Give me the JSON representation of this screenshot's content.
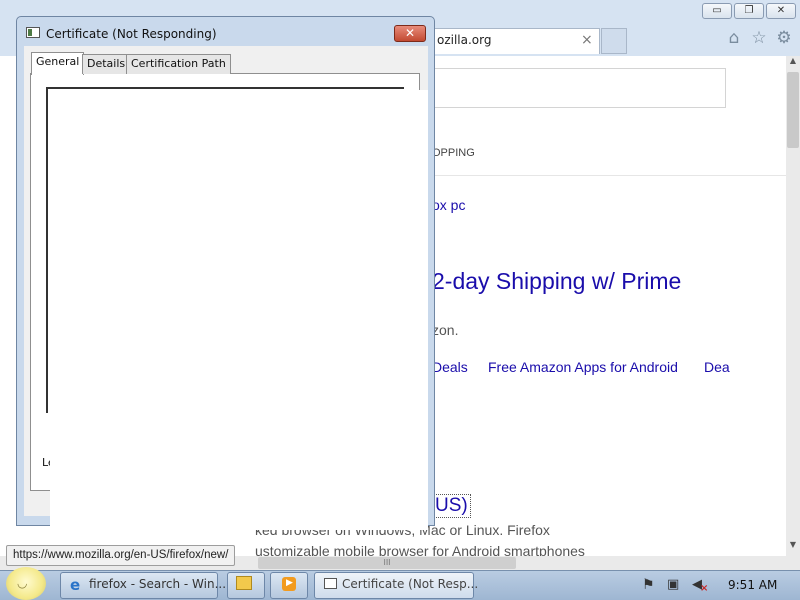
{
  "browser": {
    "tab": {
      "label": "ozilla.org",
      "close": "×"
    },
    "window_buttons": {
      "minimize": "▭",
      "maximize": "❐",
      "close": "✕"
    },
    "toolbar_icons": [
      "home-icon",
      "star-icon",
      "gear-icon"
    ]
  },
  "page": {
    "search_query": "",
    "nav_item": "OPPING",
    "related_search": "ox pc",
    "ad": {
      "title": "2-day Shipping w/ Prime",
      "description": "zon.",
      "sitelinks": [
        "Deals",
        "Free Amazon Apps for Android",
        "Dea"
      ]
    },
    "result": {
      "title": "US)",
      "desc_line_1": "ked browser on Windows, Mac or Linux. Firefox",
      "desc_line_2": "ustomizable mobile browser for Android smartphones"
    },
    "status_url": "https://www.mozilla.org/en-US/firefox/new/",
    "scroll_glyphs": {
      "up": "▲",
      "down": "▼",
      "grip": "III"
    }
  },
  "dialog": {
    "title": "Certificate (Not Responding)",
    "close": "✕",
    "tabs": [
      "General",
      "Details",
      "Certification Path"
    ],
    "learn_more_partial": "Le"
  },
  "taskbar": {
    "start_face": "◡",
    "items": [
      {
        "label": "firefox - Search - Win...",
        "icon": "ie-icon"
      },
      {
        "label": "",
        "icon": "explorer-icon"
      },
      {
        "label": "",
        "icon": "media-player-icon"
      },
      {
        "label": "Certificate (Not Resp...",
        "icon": "certificate-icon"
      }
    ],
    "ie_glyph": "e",
    "media_glyph": "▶",
    "tray": {
      "flag": "⚑",
      "network": "▣",
      "volume": "◀",
      "volume_mute": "×"
    },
    "clock": "9:51 AM"
  },
  "colors": {
    "link": "#1a0dab",
    "titlebar": "#c9d9ec",
    "taskbar": "#b9cce2",
    "close_red": "#c24a32"
  }
}
